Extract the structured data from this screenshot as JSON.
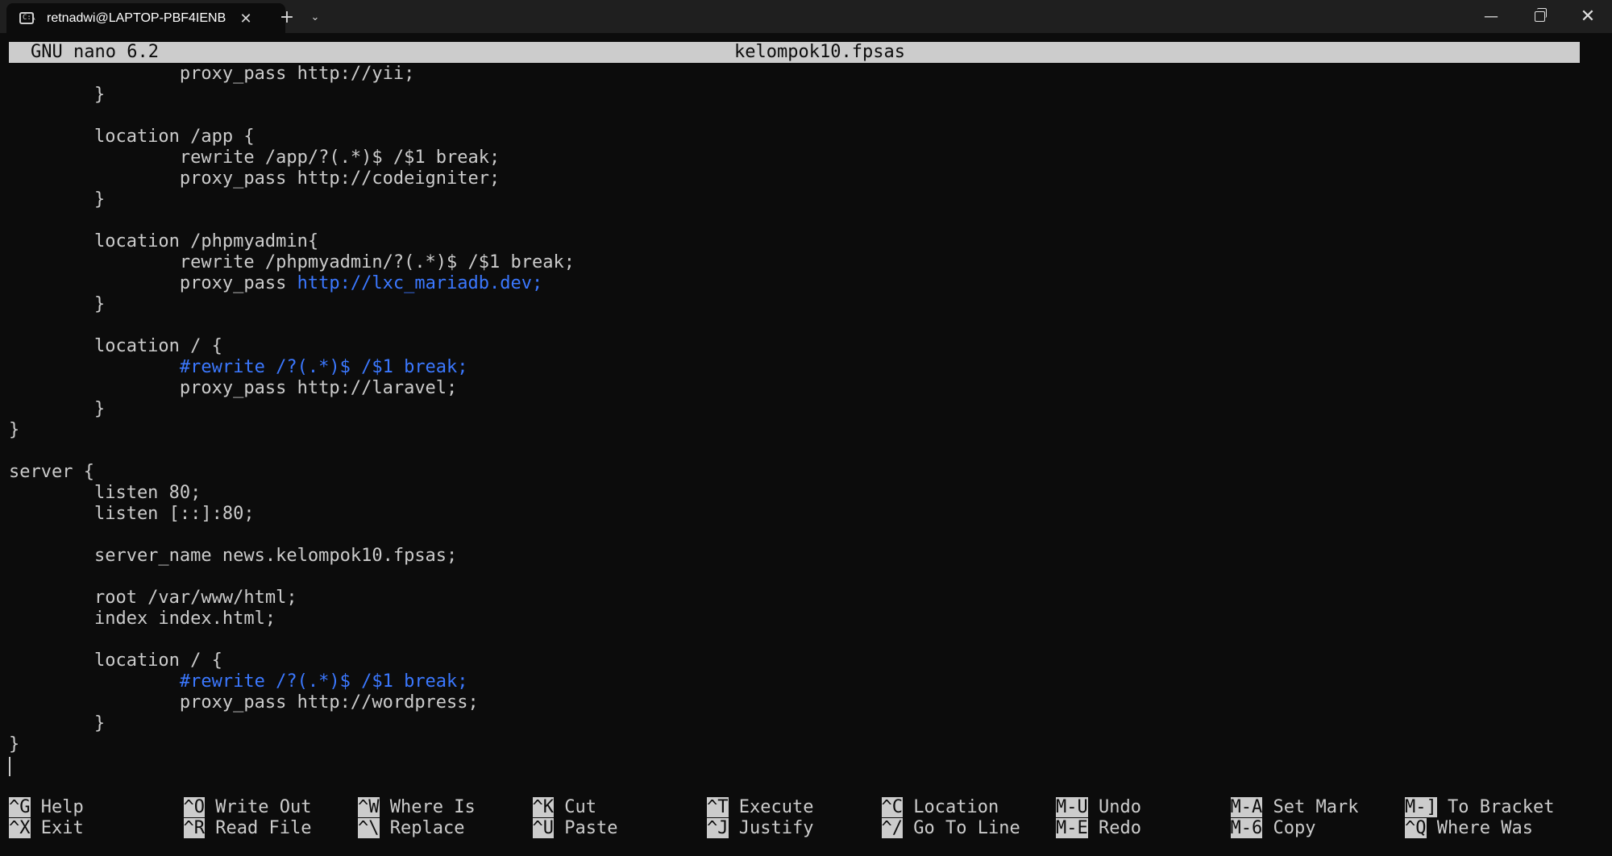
{
  "window": {
    "tab_title": "retnadwi@LAPTOP-PBF4IENB",
    "tab_close_glyph": "✕",
    "new_tab_glyph": "+",
    "dropdown_glyph": "⌄",
    "minimize_glyph": "—",
    "close_glyph": "✕"
  },
  "nano": {
    "version": "GNU nano 6.2",
    "filename": "kelompok10.fpsas"
  },
  "editor": {
    "lines": [
      {
        "text": "                proxy_pass http://yii;"
      },
      {
        "text": "        }"
      },
      {
        "text": ""
      },
      {
        "text": "        location /app {"
      },
      {
        "text": "                rewrite /app/?(.*)$ /$1 break;"
      },
      {
        "text": "                proxy_pass http://codeigniter;"
      },
      {
        "text": "        }"
      },
      {
        "text": ""
      },
      {
        "text": "        location /phpmyadmin{"
      },
      {
        "text": "                rewrite /phpmyadmin/?(.*)$ /$1 break;"
      },
      {
        "text": "                proxy_pass ",
        "highlight": "http://lxc_mariadb.dev;"
      },
      {
        "text": "        }"
      },
      {
        "text": ""
      },
      {
        "text": "        location / {"
      },
      {
        "text": "                ",
        "highlight": "#rewrite /?(.*)$ /$1 break;"
      },
      {
        "text": "                proxy_pass http://laravel;"
      },
      {
        "text": "        }"
      },
      {
        "text": "}"
      },
      {
        "text": ""
      },
      {
        "text": "server {"
      },
      {
        "text": "        listen 80;"
      },
      {
        "text": "        listen [::]:80;"
      },
      {
        "text": ""
      },
      {
        "text": "        server_name news.kelompok10.fpsas;"
      },
      {
        "text": ""
      },
      {
        "text": "        root /var/www/html;"
      },
      {
        "text": "        index index.html;"
      },
      {
        "text": ""
      },
      {
        "text": "        location / {"
      },
      {
        "text": "                ",
        "highlight": "#rewrite /?(.*)$ /$1 break;"
      },
      {
        "text": "                proxy_pass http://wordpress;"
      },
      {
        "text": "        }"
      },
      {
        "text": "}"
      }
    ]
  },
  "shortcuts": [
    {
      "key": "^G",
      "label": "Help",
      "col": 0,
      "row": 0
    },
    {
      "key": "^O",
      "label": "Write Out",
      "col": 1,
      "row": 0
    },
    {
      "key": "^W",
      "label": "Where Is",
      "col": 2,
      "row": 0
    },
    {
      "key": "^K",
      "label": "Cut",
      "col": 3,
      "row": 0
    },
    {
      "key": "^T",
      "label": "Execute",
      "col": 4,
      "row": 0
    },
    {
      "key": "^C",
      "label": "Location",
      "col": 5,
      "row": 0
    },
    {
      "key": "M-U",
      "label": "Undo",
      "col": 6,
      "row": 0
    },
    {
      "key": "M-A",
      "label": "Set Mark",
      "col": 7,
      "row": 0
    },
    {
      "key": "M-]",
      "label": "To Bracket",
      "col": 8,
      "row": 0
    },
    {
      "key": "^X",
      "label": "Exit",
      "col": 0,
      "row": 1
    },
    {
      "key": "^R",
      "label": "Read File",
      "col": 1,
      "row": 1
    },
    {
      "key": "^\\",
      "label": "Replace",
      "col": 2,
      "row": 1
    },
    {
      "key": "^U",
      "label": "Paste",
      "col": 3,
      "row": 1
    },
    {
      "key": "^J",
      "label": "Justify",
      "col": 4,
      "row": 1
    },
    {
      "key": "^/",
      "label": "Go To Line",
      "col": 5,
      "row": 1
    },
    {
      "key": "M-E",
      "label": "Redo",
      "col": 6,
      "row": 1
    },
    {
      "key": "M-6",
      "label": "Copy",
      "col": 7,
      "row": 1
    },
    {
      "key": "^Q",
      "label": "Where Was",
      "col": 8,
      "row": 1
    }
  ],
  "colors": {
    "background": "#0c0c0c",
    "foreground": "#cccccc",
    "highlight": "#3b78ff",
    "titlebar": "#1f1f1f"
  }
}
